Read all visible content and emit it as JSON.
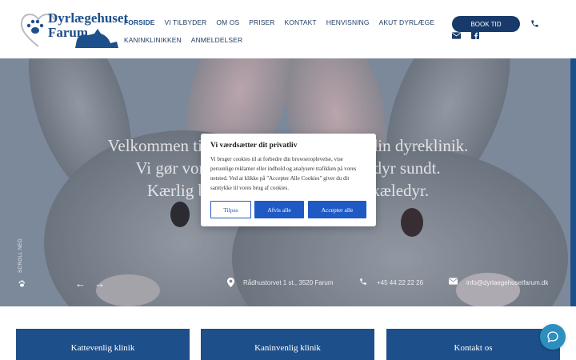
{
  "logo": {
    "line1": "Dyrlægehuset",
    "line2": "Farum"
  },
  "nav": {
    "row1": [
      "FORSIDE",
      "VI TILBYDER",
      "OM OS",
      "PRISER",
      "KONTAKT",
      "HENVISNING",
      "AKUT DYRLÆGE"
    ],
    "row2": [
      "KANINKLINIKKEN",
      "ANMELDELSER"
    ],
    "active": "FORSIDE"
  },
  "header": {
    "book_label": "BOOK TID"
  },
  "icons": {
    "phone": "phone-icon",
    "mail": "envelope-icon",
    "facebook": "facebook-icon",
    "location": "map-pin-icon",
    "chat": "chat-icon"
  },
  "hero": {
    "title_lines": [
      "Velkommen til Dyrlægehuset Farum – din dyreklinik.",
      "Vi gør vores bedste for at holde dit dyr sundt.",
      "Kærlig behandling af dit kæreste kæledyr."
    ],
    "scroll_label": "SCROLL NED",
    "address": "Rådhustorvet 1 st., 3520 Farum",
    "phone": "+45 44 22 22 26",
    "email": "info@dyrlaegehusetfarum.dk"
  },
  "cookie": {
    "title": "Vi værdsætter dit privatliv",
    "body": "Vi bruger cookies til at forbedre din browseroplevelse, vise personlige reklamer eller indhold og analysere trafikken på vores netsted. Ved at klikke på \"Accepter Alle Cookies\" giver du dit samtykke til vores brug af cookies.",
    "customize": "Tilpas",
    "reject": "Afvis alle",
    "accept": "Accepter alle"
  },
  "cards": [
    "Kattevenlig klinik",
    "Kaninvenlig klinik",
    "Kontakt os"
  ],
  "colors": {
    "brand": "#1d4f8a",
    "button_blue": "#1f5ac4",
    "chat": "#2d8fbf"
  }
}
